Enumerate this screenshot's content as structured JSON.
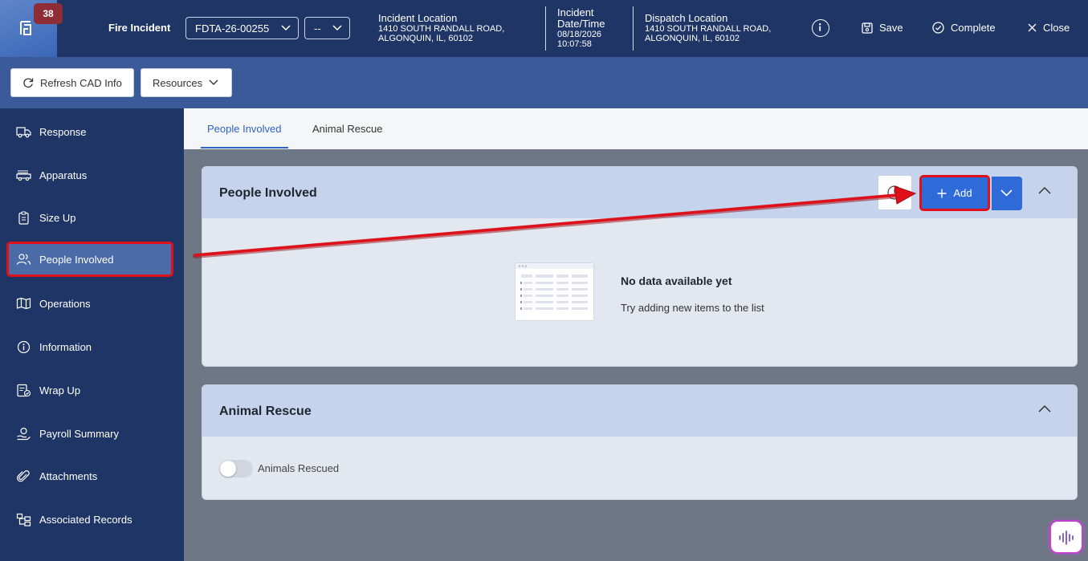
{
  "header": {
    "notification_count": "38",
    "title": "Fire Incident",
    "incident_number": "FDTA-26-00255",
    "secondary_select": "--",
    "incident_location_label": "Incident Location",
    "incident_location_line1": "1410 SOUTH RANDALL ROAD,",
    "incident_location_line2": "ALGONQUIN, IL, 60102",
    "datetime_label_line1": "Incident",
    "datetime_label_line2": "Date/Time",
    "date": "08/18/2026",
    "time": "10:07:58",
    "dispatch_location_label": "Dispatch Location",
    "dispatch_location_line1": "1410 SOUTH RANDALL ROAD,",
    "dispatch_location_line2": "ALGONQUIN, IL, 60102",
    "save_label": "Save",
    "complete_label": "Complete",
    "close_label": "Close"
  },
  "toolbar": {
    "refresh_label": "Refresh CAD Info",
    "resources_label": "Resources"
  },
  "sidebar": {
    "items": [
      {
        "label": "Response",
        "icon": "truck-icon"
      },
      {
        "label": "Apparatus",
        "icon": "fire-engine-icon"
      },
      {
        "label": "Size Up",
        "icon": "clipboard-icon"
      },
      {
        "label": "People Involved",
        "icon": "people-icon",
        "active": true
      },
      {
        "label": "Operations",
        "icon": "map-icon"
      },
      {
        "label": "Information",
        "icon": "info-icon"
      },
      {
        "label": "Wrap Up",
        "icon": "checklist-icon"
      },
      {
        "label": "Payroll Summary",
        "icon": "payroll-icon"
      },
      {
        "label": "Attachments",
        "icon": "paperclip-icon"
      },
      {
        "label": "Associated Records",
        "icon": "hierarchy-icon"
      }
    ]
  },
  "tabs": [
    {
      "label": "People Involved",
      "active": true
    },
    {
      "label": "Animal Rescue",
      "active": false
    }
  ],
  "people_section": {
    "title": "People Involved",
    "add_label": "Add",
    "empty_title": "No data available yet",
    "empty_subtitle": "Try adding new items to the list"
  },
  "animal_section": {
    "title": "Animal Rescue",
    "toggle_label": "Animals Rescued",
    "toggle_on": false
  },
  "colors": {
    "header_bg": "#1f3566",
    "toolbar_bg": "#3a5a99",
    "primary": "#2e6bd9",
    "annotation": "#e0101a",
    "section_header": "#c5d4ec"
  }
}
